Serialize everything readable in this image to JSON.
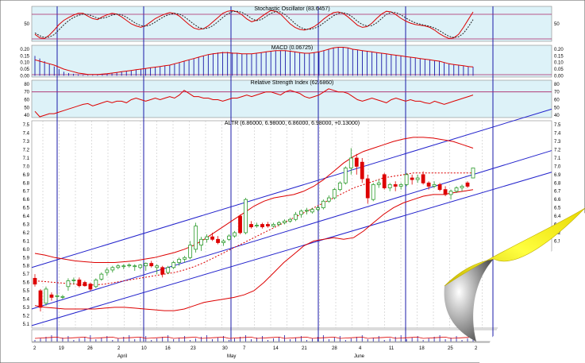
{
  "colors": {
    "panel_bg": "#ddf2f8",
    "vline": "#1a1aa8",
    "channel": "#2222cc",
    "red": "#dd0000",
    "up": "#2a9a2a",
    "down": "#dd0000",
    "page_curl": "#ffee00"
  },
  "stochastic": {
    "title": "Stochastic Oscillator (83.6457)",
    "ticks": [
      "50"
    ],
    "k": [
      20,
      10,
      8,
      18,
      32,
      48,
      60,
      68,
      75,
      80,
      80,
      72,
      65,
      62,
      70,
      76,
      80,
      78,
      70,
      60,
      50,
      44,
      40,
      45,
      55,
      65,
      72,
      78,
      82,
      80,
      72,
      60,
      48,
      38,
      34,
      36,
      44,
      56,
      68,
      80,
      86,
      88,
      84,
      76,
      64,
      56,
      60,
      70,
      80,
      88,
      86,
      78,
      64,
      50,
      40,
      34,
      32,
      36,
      42,
      52,
      64,
      74,
      82,
      84,
      80,
      70,
      58,
      46,
      40,
      42,
      52,
      66,
      78,
      86,
      84,
      76,
      66,
      58,
      52,
      48,
      46,
      44,
      40,
      32,
      22,
      14,
      8,
      10,
      20,
      40,
      62,
      84
    ],
    "d": [
      24,
      16,
      11,
      12,
      19,
      33,
      47,
      59,
      68,
      74,
      78,
      77,
      72,
      66,
      66,
      69,
      75,
      78,
      76,
      69,
      60,
      51,
      45,
      43,
      47,
      55,
      64,
      72,
      77,
      80,
      78,
      71,
      60,
      49,
      40,
      36,
      38,
      45,
      56,
      68,
      78,
      85,
      86,
      83,
      75,
      65,
      59,
      62,
      71,
      80,
      85,
      84,
      76,
      64,
      51,
      41,
      35,
      34,
      37,
      43,
      53,
      63,
      73,
      80,
      82,
      78,
      69,
      57,
      48,
      44,
      45,
      53,
      65,
      77,
      83,
      82,
      76,
      67,
      59,
      53,
      49,
      46,
      43,
      38,
      31,
      22,
      14,
      11,
      13,
      23,
      41,
      62
    ]
  },
  "macd": {
    "title": "MACD (0.06725)",
    "ticks": [
      "0.20",
      "0.15",
      "0.10",
      "0.05",
      "0.00"
    ],
    "bars": [
      0.15,
      0.13,
      0.11,
      0.09,
      0.07,
      0.05,
      0.03,
      0.02,
      0.015,
      0.01,
      0.005,
      0.005,
      0.005,
      0.007,
      0.01,
      0.015,
      0.02,
      0.025,
      0.03,
      0.035,
      0.04,
      0.045,
      0.05,
      0.055,
      0.06,
      0.065,
      0.07,
      0.075,
      0.08,
      0.09,
      0.1,
      0.11,
      0.12,
      0.13,
      0.14,
      0.15,
      0.16,
      0.17,
      0.175,
      0.18,
      0.18,
      0.175,
      0.17,
      0.165,
      0.165,
      0.165,
      0.17,
      0.175,
      0.18,
      0.185,
      0.19,
      0.19,
      0.19,
      0.185,
      0.18,
      0.175,
      0.17,
      0.17,
      0.175,
      0.18,
      0.19,
      0.2,
      0.21,
      0.215,
      0.215,
      0.21,
      0.2,
      0.195,
      0.19,
      0.185,
      0.18,
      0.175,
      0.17,
      0.165,
      0.16,
      0.155,
      0.15,
      0.145,
      0.14,
      0.135,
      0.13,
      0.125,
      0.12,
      0.115,
      0.11,
      0.1,
      0.09,
      0.085,
      0.08,
      0.075,
      0.07,
      0.067
    ],
    "signal": [
      0.12,
      0.11,
      0.1,
      0.09,
      0.08,
      0.065,
      0.05,
      0.04,
      0.03,
      0.02,
      0.015,
      0.01,
      0.01,
      0.01,
      0.012,
      0.015,
      0.02,
      0.025,
      0.03,
      0.035,
      0.04,
      0.045,
      0.05,
      0.055,
      0.06,
      0.065,
      0.07,
      0.075,
      0.08,
      0.09,
      0.1,
      0.11,
      0.12,
      0.13,
      0.14,
      0.15,
      0.16,
      0.165,
      0.17,
      0.175,
      0.175,
      0.17,
      0.17,
      0.165,
      0.165,
      0.165,
      0.17,
      0.175,
      0.18,
      0.185,
      0.19,
      0.19,
      0.19,
      0.185,
      0.18,
      0.175,
      0.17,
      0.17,
      0.175,
      0.18,
      0.19,
      0.2,
      0.21,
      0.215,
      0.215,
      0.21,
      0.2,
      0.195,
      0.19,
      0.185,
      0.18,
      0.175,
      0.17,
      0.165,
      0.16,
      0.155,
      0.15,
      0.145,
      0.14,
      0.135,
      0.13,
      0.125,
      0.12,
      0.115,
      0.11,
      0.1,
      0.09,
      0.085,
      0.08,
      0.075,
      0.07,
      0.067
    ]
  },
  "rsi": {
    "title": "Relative Strength Index (62.6860)",
    "ticks": [
      "80",
      "70",
      "60",
      "50",
      "40"
    ],
    "values": [
      45,
      38,
      40,
      42,
      42,
      44,
      46,
      48,
      50,
      52,
      54,
      55,
      52,
      54,
      56,
      58,
      56,
      58,
      58,
      56,
      60,
      62,
      60,
      58,
      60,
      62,
      60,
      62,
      64,
      62,
      66,
      72,
      68,
      64,
      64,
      62,
      62,
      60,
      60,
      58,
      60,
      62,
      62,
      64,
      66,
      64,
      66,
      68,
      70,
      70,
      68,
      66,
      70,
      72,
      70,
      68,
      64,
      62,
      64,
      66,
      70,
      74,
      72,
      70,
      70,
      68,
      64,
      60,
      58,
      60,
      62,
      60,
      58,
      56,
      60,
      62,
      60,
      58,
      60,
      58,
      58,
      56,
      55,
      58,
      56,
      54,
      56,
      58,
      60,
      62,
      64,
      66
    ]
  },
  "price": {
    "title": "ALTR (6.86000, 6.98000, 6.86000, 6.98000, +0.13000)",
    "ticks": [
      "7.5",
      "7.4",
      "7.3",
      "7.2",
      "7.1",
      "7.0",
      "6.9",
      "6.8",
      "6.7",
      "6.6",
      "6.5",
      "6.4",
      "6.3",
      "6.2",
      "6.1",
      "6.0",
      "5.9",
      "5.8",
      "5.7",
      "5.6",
      "5.5",
      "5.4",
      "5.3",
      "5.2",
      "5.1"
    ],
    "ylim": [
      5.05,
      7.55
    ]
  },
  "chart_data": {
    "type": "candlestick",
    "title": "ALTR (6.86000, 6.98000, 6.86000, 6.98000, +0.13000)",
    "ylim": [
      5.05,
      7.55
    ],
    "x_ticks": [
      "2",
      "19",
      "26",
      "2",
      "10",
      "16",
      "23",
      "30",
      "7",
      "14",
      "21",
      "28",
      "4",
      "11",
      "18",
      "25",
      "2"
    ],
    "months": [
      "April",
      "May",
      "June"
    ],
    "candles": [
      {
        "o": 5.65,
        "h": 5.7,
        "l": 5.55,
        "c": 5.58
      },
      {
        "o": 5.5,
        "h": 5.52,
        "l": 5.25,
        "c": 5.3
      },
      {
        "o": 5.35,
        "h": 5.55,
        "l": 5.32,
        "c": 5.52
      },
      {
        "o": 5.45,
        "h": 5.48,
        "l": 5.38,
        "c": 5.42
      },
      {
        "o": 5.43,
        "h": 5.46,
        "l": 5.4,
        "c": 5.44
      },
      {
        "o": 5.42,
        "h": 5.45,
        "l": 5.4,
        "c": 5.43
      },
      {
        "o": 5.55,
        "h": 5.65,
        "l": 5.5,
        "c": 5.62
      },
      {
        "o": 5.62,
        "h": 5.66,
        "l": 5.58,
        "c": 5.63
      },
      {
        "o": 5.63,
        "h": 5.66,
        "l": 5.54,
        "c": 5.56
      },
      {
        "o": 5.6,
        "h": 5.62,
        "l": 5.55,
        "c": 5.56
      },
      {
        "o": 5.58,
        "h": 5.6,
        "l": 5.5,
        "c": 5.52
      },
      {
        "o": 5.55,
        "h": 5.65,
        "l": 5.53,
        "c": 5.63
      },
      {
        "o": 5.64,
        "h": 5.72,
        "l": 5.62,
        "c": 5.7
      },
      {
        "o": 5.72,
        "h": 5.78,
        "l": 5.68,
        "c": 5.75
      },
      {
        "o": 5.75,
        "h": 5.8,
        "l": 5.72,
        "c": 5.78
      },
      {
        "o": 5.78,
        "h": 5.82,
        "l": 5.76,
        "c": 5.8
      },
      {
        "o": 5.8,
        "h": 5.82,
        "l": 5.76,
        "c": 5.8
      },
      {
        "o": 5.8,
        "h": 5.83,
        "l": 5.78,
        "c": 5.81
      },
      {
        "o": 5.8,
        "h": 5.82,
        "l": 5.74,
        "c": 5.8
      },
      {
        "o": 5.78,
        "h": 5.82,
        "l": 5.76,
        "c": 5.81
      },
      {
        "o": 5.8,
        "h": 5.84,
        "l": 5.74,
        "c": 5.83
      },
      {
        "o": 5.83,
        "h": 5.86,
        "l": 5.78,
        "c": 5.8
      },
      {
        "o": 5.78,
        "h": 5.82,
        "l": 5.7,
        "c": 5.8
      },
      {
        "o": 5.78,
        "h": 5.8,
        "l": 5.66,
        "c": 5.7
      },
      {
        "o": 5.72,
        "h": 5.8,
        "l": 5.7,
        "c": 5.78
      },
      {
        "o": 5.78,
        "h": 5.86,
        "l": 5.76,
        "c": 5.84
      },
      {
        "o": 5.84,
        "h": 5.9,
        "l": 5.8,
        "c": 5.88
      },
      {
        "o": 5.88,
        "h": 5.92,
        "l": 5.84,
        "c": 5.9
      },
      {
        "o": 5.9,
        "h": 6.1,
        "l": 5.88,
        "c": 6.05
      },
      {
        "o": 6.0,
        "h": 6.32,
        "l": 5.96,
        "c": 6.28
      },
      {
        "o": 6.05,
        "h": 6.15,
        "l": 5.98,
        "c": 6.12
      },
      {
        "o": 6.12,
        "h": 6.18,
        "l": 6.08,
        "c": 6.15
      },
      {
        "o": 6.15,
        "h": 6.2,
        "l": 6.1,
        "c": 6.12
      },
      {
        "o": 6.12,
        "h": 6.16,
        "l": 6.06,
        "c": 6.08
      },
      {
        "o": 6.08,
        "h": 6.12,
        "l": 6.04,
        "c": 6.1
      },
      {
        "o": 6.12,
        "h": 6.18,
        "l": 6.1,
        "c": 6.16
      },
      {
        "o": 6.16,
        "h": 6.22,
        "l": 6.14,
        "c": 6.2
      },
      {
        "o": 6.4,
        "h": 6.42,
        "l": 6.18,
        "c": 6.2
      },
      {
        "o": 6.2,
        "h": 6.62,
        "l": 6.18,
        "c": 6.6
      },
      {
        "o": 6.3,
        "h": 6.34,
        "l": 6.25,
        "c": 6.27
      },
      {
        "o": 6.28,
        "h": 6.32,
        "l": 6.26,
        "c": 6.29
      },
      {
        "o": 6.3,
        "h": 6.32,
        "l": 6.25,
        "c": 6.27
      },
      {
        "o": 6.3,
        "h": 6.33,
        "l": 6.26,
        "c": 6.28
      },
      {
        "o": 6.28,
        "h": 6.32,
        "l": 6.26,
        "c": 6.3
      },
      {
        "o": 6.3,
        "h": 6.34,
        "l": 6.28,
        "c": 6.32
      },
      {
        "o": 6.32,
        "h": 6.36,
        "l": 6.3,
        "c": 6.34
      },
      {
        "o": 6.34,
        "h": 6.38,
        "l": 6.32,
        "c": 6.36
      },
      {
        "o": 6.36,
        "h": 6.45,
        "l": 6.34,
        "c": 6.42
      },
      {
        "o": 6.42,
        "h": 6.48,
        "l": 6.38,
        "c": 6.46
      },
      {
        "o": 6.46,
        "h": 6.5,
        "l": 6.42,
        "c": 6.47
      },
      {
        "o": 6.45,
        "h": 6.5,
        "l": 6.43,
        "c": 6.48
      },
      {
        "o": 6.48,
        "h": 6.52,
        "l": 6.46,
        "c": 6.5
      },
      {
        "o": 6.5,
        "h": 6.6,
        "l": 6.48,
        "c": 6.58
      },
      {
        "o": 6.58,
        "h": 6.65,
        "l": 6.56,
        "c": 6.62
      },
      {
        "o": 6.62,
        "h": 6.74,
        "l": 6.6,
        "c": 6.72
      },
      {
        "o": 6.72,
        "h": 6.82,
        "l": 6.7,
        "c": 6.8
      },
      {
        "o": 6.8,
        "h": 7.0,
        "l": 6.78,
        "c": 6.98
      },
      {
        "o": 6.98,
        "h": 7.22,
        "l": 6.9,
        "c": 7.1
      },
      {
        "o": 7.1,
        "h": 7.15,
        "l": 6.9,
        "c": 7.0
      },
      {
        "o": 7.05,
        "h": 7.1,
        "l": 6.8,
        "c": 6.85
      },
      {
        "o": 6.85,
        "h": 6.9,
        "l": 6.55,
        "c": 6.62
      },
      {
        "o": 6.6,
        "h": 6.8,
        "l": 6.58,
        "c": 6.78
      },
      {
        "o": 6.78,
        "h": 6.84,
        "l": 6.74,
        "c": 6.8
      },
      {
        "o": 6.9,
        "h": 6.92,
        "l": 6.72,
        "c": 6.74
      },
      {
        "o": 6.74,
        "h": 6.8,
        "l": 6.7,
        "c": 6.78
      },
      {
        "o": 6.78,
        "h": 6.82,
        "l": 6.7,
        "c": 6.76
      },
      {
        "o": 6.76,
        "h": 6.8,
        "l": 6.72,
        "c": 6.78
      },
      {
        "o": 6.78,
        "h": 6.92,
        "l": 6.76,
        "c": 6.9
      },
      {
        "o": 6.86,
        "h": 6.9,
        "l": 6.78,
        "c": 6.84
      },
      {
        "o": 6.84,
        "h": 6.9,
        "l": 6.8,
        "c": 6.86
      },
      {
        "o": 6.9,
        "h": 6.94,
        "l": 6.78,
        "c": 6.8
      },
      {
        "o": 6.8,
        "h": 6.82,
        "l": 6.72,
        "c": 6.76
      },
      {
        "o": 6.76,
        "h": 6.82,
        "l": 6.74,
        "c": 6.78
      },
      {
        "o": 6.78,
        "h": 6.8,
        "l": 6.7,
        "c": 6.72
      },
      {
        "o": 6.72,
        "h": 6.76,
        "l": 6.64,
        "c": 6.66
      },
      {
        "o": 6.66,
        "h": 6.72,
        "l": 6.6,
        "c": 6.7
      },
      {
        "o": 6.7,
        "h": 6.76,
        "l": 6.68,
        "c": 6.74
      },
      {
        "o": 6.74,
        "h": 6.78,
        "l": 6.7,
        "c": 6.76
      },
      {
        "o": 6.8,
        "h": 6.82,
        "l": 6.74,
        "c": 6.76
      },
      {
        "o": 6.86,
        "h": 6.98,
        "l": 6.86,
        "c": 6.98
      }
    ],
    "bollinger_upper": [
      5.95,
      5.93,
      5.9,
      5.88,
      5.86,
      5.85,
      5.84,
      5.84,
      5.84,
      5.85,
      5.86,
      5.88,
      5.9,
      5.93,
      5.96,
      6.0,
      6.05,
      6.12,
      6.2,
      6.28,
      6.36,
      6.44,
      6.52,
      6.58,
      6.62,
      6.64,
      6.66,
      6.7,
      6.76,
      6.84,
      6.94,
      7.04,
      7.12,
      7.18,
      7.22,
      7.26,
      7.3,
      7.33,
      7.35,
      7.35,
      7.34,
      7.32,
      7.3,
      7.26,
      7.22
    ],
    "bollinger_lower": [
      5.32,
      5.3,
      5.29,
      5.28,
      5.28,
      5.28,
      5.28,
      5.29,
      5.3,
      5.3,
      5.29,
      5.28,
      5.27,
      5.26,
      5.26,
      5.28,
      5.32,
      5.36,
      5.38,
      5.4,
      5.42,
      5.45,
      5.5,
      5.6,
      5.72,
      5.84,
      5.94,
      6.04,
      6.1,
      6.12,
      6.14,
      6.12,
      6.14,
      6.22,
      6.32,
      6.42,
      6.5,
      6.56,
      6.6,
      6.64,
      6.66,
      6.66,
      6.68,
      6.7,
      6.72
    ],
    "bollinger_middle": [
      5.62,
      5.61,
      5.6,
      5.59,
      5.58,
      5.57,
      5.57,
      5.58,
      5.6,
      5.62,
      5.64,
      5.66,
      5.68,
      5.7,
      5.72,
      5.75,
      5.79,
      5.84,
      5.9,
      5.96,
      6.02,
      6.08,
      6.14,
      6.2,
      6.26,
      6.32,
      6.38,
      6.44,
      6.5,
      6.56,
      6.62,
      6.68,
      6.74,
      6.78,
      6.82,
      6.86,
      6.88,
      6.9,
      6.92,
      6.92,
      6.92,
      6.92,
      6.92,
      6.92,
      6.92
    ],
    "channel_lines": [
      [
        5.08,
        6.93
      ],
      [
        5.28,
        7.19
      ],
      [
        5.78,
        7.69
      ]
    ]
  }
}
